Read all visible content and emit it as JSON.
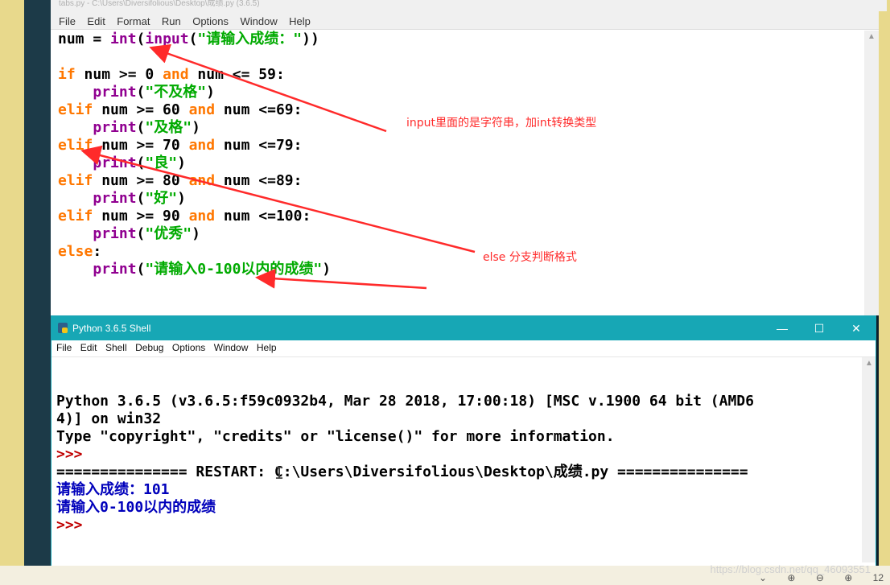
{
  "editor": {
    "title": "tabs.py - C:\\Users\\Diversifolious\\Desktop\\成绩.py (3.6.5)",
    "menu": [
      "File",
      "Edit",
      "Format",
      "Run",
      "Options",
      "Window",
      "Help"
    ],
    "code": [
      [
        {
          "t": "num = ",
          "c": "p"
        },
        {
          "t": "int",
          "c": "bi"
        },
        {
          "t": "(",
          "c": "p"
        },
        {
          "t": "input",
          "c": "bi"
        },
        {
          "t": "(",
          "c": "p"
        },
        {
          "t": "\"请输入成绩：\"",
          "c": "str"
        },
        {
          "t": "))",
          "c": "p"
        }
      ],
      [],
      [
        {
          "t": "if",
          "c": "kw"
        },
        {
          "t": " num >= 0 ",
          "c": "p"
        },
        {
          "t": "and",
          "c": "kw"
        },
        {
          "t": " num <= 59:",
          "c": "p"
        }
      ],
      [
        {
          "t": "    ",
          "c": "p"
        },
        {
          "t": "print",
          "c": "bi"
        },
        {
          "t": "(",
          "c": "p"
        },
        {
          "t": "\"不及格\"",
          "c": "str"
        },
        {
          "t": ")",
          "c": "p"
        }
      ],
      [
        {
          "t": "elif",
          "c": "kw"
        },
        {
          "t": " num >= 60 ",
          "c": "p"
        },
        {
          "t": "and",
          "c": "kw"
        },
        {
          "t": " num <=69:",
          "c": "p"
        }
      ],
      [
        {
          "t": "    ",
          "c": "p"
        },
        {
          "t": "print",
          "c": "bi"
        },
        {
          "t": "(",
          "c": "p"
        },
        {
          "t": "\"及格\"",
          "c": "str"
        },
        {
          "t": ")",
          "c": "p"
        }
      ],
      [
        {
          "t": "elif",
          "c": "kw"
        },
        {
          "t": " num >= 70 ",
          "c": "p"
        },
        {
          "t": "and",
          "c": "kw"
        },
        {
          "t": " num <=79:",
          "c": "p"
        }
      ],
      [
        {
          "t": "    ",
          "c": "p"
        },
        {
          "t": "print",
          "c": "bi"
        },
        {
          "t": "(",
          "c": "p"
        },
        {
          "t": "\"良\"",
          "c": "str"
        },
        {
          "t": ")",
          "c": "p"
        }
      ],
      [
        {
          "t": "elif",
          "c": "kw"
        },
        {
          "t": " num >= 80 ",
          "c": "p"
        },
        {
          "t": "and",
          "c": "kw"
        },
        {
          "t": " num <=89:",
          "c": "p"
        }
      ],
      [
        {
          "t": "    ",
          "c": "p"
        },
        {
          "t": "print",
          "c": "bi"
        },
        {
          "t": "(",
          "c": "p"
        },
        {
          "t": "\"好\"",
          "c": "str"
        },
        {
          "t": ")",
          "c": "p"
        }
      ],
      [
        {
          "t": "elif",
          "c": "kw"
        },
        {
          "t": " num >= 90 ",
          "c": "p"
        },
        {
          "t": "and",
          "c": "kw"
        },
        {
          "t": " num <=100:",
          "c": "p"
        }
      ],
      [
        {
          "t": "    ",
          "c": "p"
        },
        {
          "t": "print",
          "c": "bi"
        },
        {
          "t": "(",
          "c": "p"
        },
        {
          "t": "\"优秀\"",
          "c": "str"
        },
        {
          "t": ")",
          "c": "p"
        }
      ],
      [
        {
          "t": "else",
          "c": "kw"
        },
        {
          "t": ":",
          "c": "p"
        }
      ],
      [
        {
          "t": "    ",
          "c": "p"
        },
        {
          "t": "print",
          "c": "bi"
        },
        {
          "t": "(",
          "c": "p"
        },
        {
          "t": "\"请输入0-100以内的成绩\"",
          "c": "str"
        },
        {
          "t": ")",
          "c": "p"
        }
      ]
    ]
  },
  "annotations": {
    "input_note": "input里面的是字符串，加int转换类型",
    "else_note": "else 分支判断格式",
    "arrow_color": "#ff2a2a"
  },
  "shell": {
    "title": "Python 3.6.5 Shell",
    "window_buttons": {
      "minimize": "—",
      "maximize": "☐",
      "close": "✕"
    },
    "menu": [
      "File",
      "Edit",
      "Shell",
      "Debug",
      "Options",
      "Window",
      "Help"
    ],
    "lines": [
      {
        "text": "Python 3.6.5 (v3.6.5:f59c0932b4, Mar 28 2018, 17:00:18) [MSC v.1900 64 bit (AMD6",
        "c": "p"
      },
      {
        "text": "4)] on win32",
        "c": "p"
      },
      {
        "text": "Type \"copyright\", \"credits\" or \"license()\" for more information.",
        "c": "p"
      },
      {
        "text": ">>> ",
        "c": "prompt"
      },
      {
        "text": "=============== RESTART: C:\\Users\\Diversifolious\\Desktop\\成绩.py ===============",
        "c": "p"
      },
      {
        "text": "请输入成绩：101",
        "c": "out"
      },
      {
        "text": "请输入0-100以内的成绩",
        "c": "out"
      },
      {
        "text": ">>> ",
        "c": "prompt"
      }
    ]
  },
  "watermark": "https://blog.csdn.net/qq_46093551",
  "bottom_controls": [
    "⌄",
    "⊕",
    "⊖",
    "⊕",
    "12"
  ]
}
